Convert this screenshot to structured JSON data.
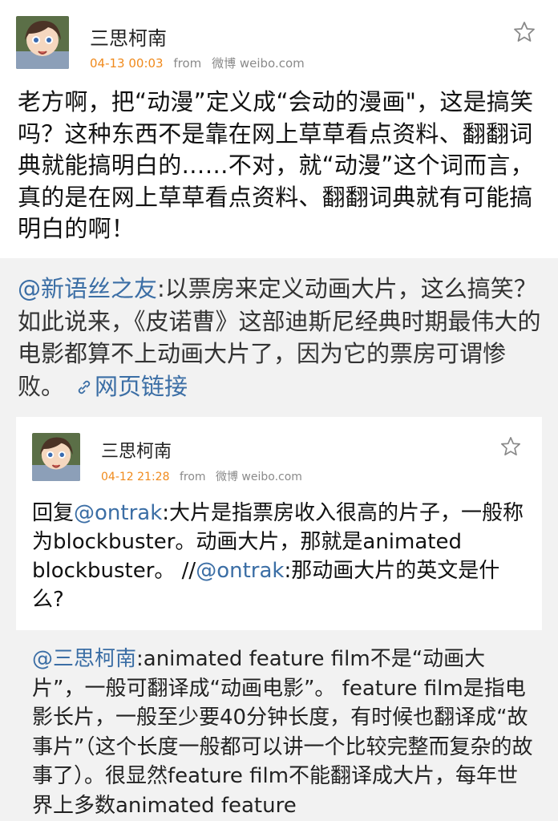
{
  "post": {
    "author": "三思柯南",
    "time": "04-13 00:03",
    "from_label": "from",
    "source": "微博 weibo.com",
    "text": "老方啊，把“动漫”定义成“会动的漫画\"，这是搞笑吗？这种东西不是靠在网上草草看点资料、翻翻词典就能搞明白的……不对，就“动漫”这个词而言，真的是在网上草草看点资料、翻翻词典就有可能搞明白的啊！"
  },
  "repost": {
    "mention": "@新语丝之友",
    "text": ":以票房来定义动画大片，这么搞笑？如此说来，《皮诺曹》这部迪斯尼经典时期最伟大的电影都算不上动画大片了，因为它的票房可谓惨败。",
    "link_label": "网页链接"
  },
  "nested": {
    "author": "三思柯南",
    "time": "04-12 21:28",
    "from_label": "from",
    "source": "微博 weibo.com",
    "reply_prefix": "回复",
    "reply_mention": "@ontrak",
    "reply_text": ":大片是指票房收入很高的片子，一般称为blockbuster。动画大片，那就是animated blockbuster。 //",
    "reply_mention2": "@ontrak",
    "reply_text2": ":那动画大片的英文是什么?"
  },
  "comment": {
    "mention": "@三思柯南",
    "text": ":animated feature film不是“动画大片”，一般可翻译成“动画电影”。 feature film是指电影长片，一般至少要40分钟长度，有时候也翻译成“故事片”（这个长度一般都可以讲一个比较完整而复杂的故事了）。很显然feature film不能翻译成大片，每年世界上多数animated feature"
  },
  "colors": {
    "time": "#f08a1c",
    "mention": "#3b6ea5",
    "repost_bg": "#f2f2f2"
  },
  "icons": {
    "favorite": "star-icon",
    "link": "link-icon"
  }
}
